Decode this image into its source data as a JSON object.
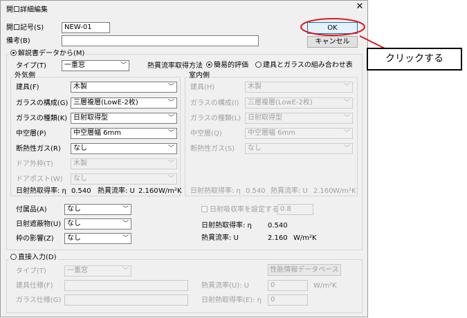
{
  "window": {
    "title": "開口詳細編集",
    "close": "✕"
  },
  "top": {
    "opening_no_label": "開口記号(S)",
    "opening_no_value": "NEW-01",
    "remarks_label": "備考(B)",
    "remarks_value": "",
    "ok_label": "OK",
    "cancel_label": "キャンセル"
  },
  "callout": {
    "text": "クリックする",
    "accent": "#e0161d"
  },
  "catalog": {
    "radio_label": "解説書データから(M)",
    "type_label": "タイプ(T)",
    "type_value": "一重窓",
    "method_label": "熱貫流率取得方法",
    "method_simple": "簡易的評価",
    "method_combo": "建具とガラスの組み合わせ表"
  },
  "outer": {
    "title": "外気側",
    "rows": [
      {
        "label": "建具(F)",
        "value": "木製"
      },
      {
        "label": "ガラスの構成(G)",
        "value": "三層複層(LowE-2枚)"
      },
      {
        "label": "ガラスの種類(K)",
        "value": "日射取得型"
      },
      {
        "label": "中空層(P)",
        "value": "中空層幅 6mm"
      },
      {
        "label": "断熱性ガス(R)",
        "value": "なし"
      },
      {
        "label": "ドア外枠(T)",
        "value": "木製"
      },
      {
        "label": "ドアポスト(W)",
        "value": "なし"
      }
    ],
    "shgc_label": "日射熱取得率: η",
    "shgc_value": "0.540",
    "u_label": "熱貫流率: U",
    "u_value": "2.160",
    "u_unit": "W/m²K"
  },
  "inner": {
    "title": "室内側",
    "rows": [
      {
        "label": "建具(H)",
        "value": "木製"
      },
      {
        "label": "ガラスの構成(I)",
        "value": "三層複層(LowE-2枚)"
      },
      {
        "label": "ガラスの種類(L)",
        "value": "日射取得型"
      },
      {
        "label": "中空層(Q)",
        "value": "中空層幅 6mm"
      },
      {
        "label": "断熱性ガス(S)",
        "value": "なし"
      }
    ],
    "shgc_label": "日射熱取得率: η",
    "shgc_value": "0.540",
    "u_label": "熱貫流率: U",
    "u_value": "2.160",
    "u_unit": "W/m²K"
  },
  "accessories": [
    {
      "label": "付属品(A)",
      "value": "なし"
    },
    {
      "label": "日射遮蔽物(U)",
      "value": "なし"
    },
    {
      "label": "枠の影響(Z)",
      "value": "なし"
    }
  ],
  "absorb": {
    "label": "日射吸収率を設定する",
    "value": "0.8"
  },
  "summary": {
    "shgc_label": "日射熱取得率: η",
    "shgc_value": "0.540",
    "u_label": "熱貫流率: U",
    "u_value": "2.160",
    "u_unit": "W/m²K"
  },
  "direct": {
    "radio_label": "直接入力(D)",
    "type_label": "タイプ(T)",
    "type_value": "一重窓",
    "perf_button": "性能情報データベース",
    "fitting_label": "建具仕様(F)",
    "glass_label": "ガラス仕様(G)",
    "u_label": "熱貫流率(U): U",
    "u_value": "0",
    "u_unit": "W/m²K",
    "shgc_label": "日射熱取得率(E): η",
    "shgc_value": "0"
  }
}
